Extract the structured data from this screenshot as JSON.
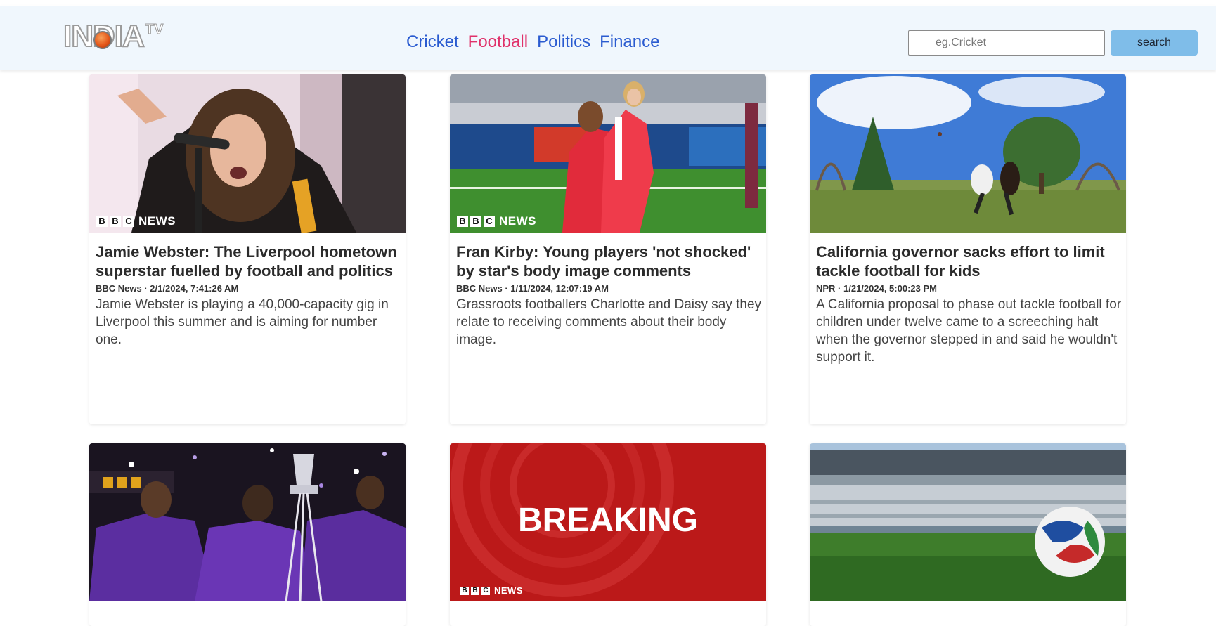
{
  "brand": {
    "logo_main": "INDIA",
    "logo_sub": "TV"
  },
  "nav": {
    "items": [
      {
        "label": "Cricket"
      },
      {
        "label": "Football"
      },
      {
        "label": "Politics"
      },
      {
        "label": "Finance"
      }
    ],
    "active": "Football"
  },
  "search": {
    "placeholder": "eg.Cricket",
    "value": "",
    "button_label": "search"
  },
  "image_overlays": {
    "bbc_letters": [
      "B",
      "B",
      "C"
    ],
    "bbc_news_label": "NEWS",
    "breaking_label": "BREAKING"
  },
  "articles": [
    {
      "title": "Jamie Webster: The Liverpool hometown superstar fuelled by football and politics",
      "meta": "BBC News · 2/1/2024, 7:41:26 AM",
      "description": "Jamie Webster is playing a 40,000-capacity gig in Liverpool this summer and is aiming for number one."
    },
    {
      "title": "Fran Kirby: Young players 'not shocked' by star's body image comments",
      "meta": "BBC News · 1/11/2024, 12:07:19 AM",
      "description": "Grassroots footballers Charlotte and Daisy say they relate to receiving comments about their body image."
    },
    {
      "title": "California governor sacks effort to limit tackle football for kids",
      "meta": "NPR · 1/21/2024, 5:00:23 PM",
      "description": "A California proposal to phase out tackle football for children under twelve came to a screeching halt when the governor stepped in and said he wouldn't support it."
    }
  ]
}
